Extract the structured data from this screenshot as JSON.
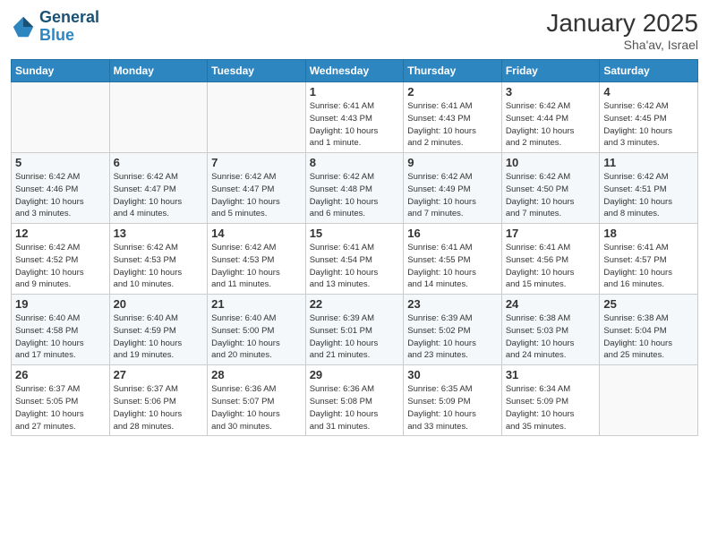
{
  "logo": {
    "line1": "General",
    "line2": "Blue"
  },
  "header": {
    "month": "January 2025",
    "location": "Sha'av, Israel"
  },
  "weekdays": [
    "Sunday",
    "Monday",
    "Tuesday",
    "Wednesday",
    "Thursday",
    "Friday",
    "Saturday"
  ],
  "weeks": [
    [
      {
        "day": "",
        "info": ""
      },
      {
        "day": "",
        "info": ""
      },
      {
        "day": "",
        "info": ""
      },
      {
        "day": "1",
        "info": "Sunrise: 6:41 AM\nSunset: 4:43 PM\nDaylight: 10 hours\nand 1 minute."
      },
      {
        "day": "2",
        "info": "Sunrise: 6:41 AM\nSunset: 4:43 PM\nDaylight: 10 hours\nand 2 minutes."
      },
      {
        "day": "3",
        "info": "Sunrise: 6:42 AM\nSunset: 4:44 PM\nDaylight: 10 hours\nand 2 minutes."
      },
      {
        "day": "4",
        "info": "Sunrise: 6:42 AM\nSunset: 4:45 PM\nDaylight: 10 hours\nand 3 minutes."
      }
    ],
    [
      {
        "day": "5",
        "info": "Sunrise: 6:42 AM\nSunset: 4:46 PM\nDaylight: 10 hours\nand 3 minutes."
      },
      {
        "day": "6",
        "info": "Sunrise: 6:42 AM\nSunset: 4:47 PM\nDaylight: 10 hours\nand 4 minutes."
      },
      {
        "day": "7",
        "info": "Sunrise: 6:42 AM\nSunset: 4:47 PM\nDaylight: 10 hours\nand 5 minutes."
      },
      {
        "day": "8",
        "info": "Sunrise: 6:42 AM\nSunset: 4:48 PM\nDaylight: 10 hours\nand 6 minutes."
      },
      {
        "day": "9",
        "info": "Sunrise: 6:42 AM\nSunset: 4:49 PM\nDaylight: 10 hours\nand 7 minutes."
      },
      {
        "day": "10",
        "info": "Sunrise: 6:42 AM\nSunset: 4:50 PM\nDaylight: 10 hours\nand 7 minutes."
      },
      {
        "day": "11",
        "info": "Sunrise: 6:42 AM\nSunset: 4:51 PM\nDaylight: 10 hours\nand 8 minutes."
      }
    ],
    [
      {
        "day": "12",
        "info": "Sunrise: 6:42 AM\nSunset: 4:52 PM\nDaylight: 10 hours\nand 9 minutes."
      },
      {
        "day": "13",
        "info": "Sunrise: 6:42 AM\nSunset: 4:53 PM\nDaylight: 10 hours\nand 10 minutes."
      },
      {
        "day": "14",
        "info": "Sunrise: 6:42 AM\nSunset: 4:53 PM\nDaylight: 10 hours\nand 11 minutes."
      },
      {
        "day": "15",
        "info": "Sunrise: 6:41 AM\nSunset: 4:54 PM\nDaylight: 10 hours\nand 13 minutes."
      },
      {
        "day": "16",
        "info": "Sunrise: 6:41 AM\nSunset: 4:55 PM\nDaylight: 10 hours\nand 14 minutes."
      },
      {
        "day": "17",
        "info": "Sunrise: 6:41 AM\nSunset: 4:56 PM\nDaylight: 10 hours\nand 15 minutes."
      },
      {
        "day": "18",
        "info": "Sunrise: 6:41 AM\nSunset: 4:57 PM\nDaylight: 10 hours\nand 16 minutes."
      }
    ],
    [
      {
        "day": "19",
        "info": "Sunrise: 6:40 AM\nSunset: 4:58 PM\nDaylight: 10 hours\nand 17 minutes."
      },
      {
        "day": "20",
        "info": "Sunrise: 6:40 AM\nSunset: 4:59 PM\nDaylight: 10 hours\nand 19 minutes."
      },
      {
        "day": "21",
        "info": "Sunrise: 6:40 AM\nSunset: 5:00 PM\nDaylight: 10 hours\nand 20 minutes."
      },
      {
        "day": "22",
        "info": "Sunrise: 6:39 AM\nSunset: 5:01 PM\nDaylight: 10 hours\nand 21 minutes."
      },
      {
        "day": "23",
        "info": "Sunrise: 6:39 AM\nSunset: 5:02 PM\nDaylight: 10 hours\nand 23 minutes."
      },
      {
        "day": "24",
        "info": "Sunrise: 6:38 AM\nSunset: 5:03 PM\nDaylight: 10 hours\nand 24 minutes."
      },
      {
        "day": "25",
        "info": "Sunrise: 6:38 AM\nSunset: 5:04 PM\nDaylight: 10 hours\nand 25 minutes."
      }
    ],
    [
      {
        "day": "26",
        "info": "Sunrise: 6:37 AM\nSunset: 5:05 PM\nDaylight: 10 hours\nand 27 minutes."
      },
      {
        "day": "27",
        "info": "Sunrise: 6:37 AM\nSunset: 5:06 PM\nDaylight: 10 hours\nand 28 minutes."
      },
      {
        "day": "28",
        "info": "Sunrise: 6:36 AM\nSunset: 5:07 PM\nDaylight: 10 hours\nand 30 minutes."
      },
      {
        "day": "29",
        "info": "Sunrise: 6:36 AM\nSunset: 5:08 PM\nDaylight: 10 hours\nand 31 minutes."
      },
      {
        "day": "30",
        "info": "Sunrise: 6:35 AM\nSunset: 5:09 PM\nDaylight: 10 hours\nand 33 minutes."
      },
      {
        "day": "31",
        "info": "Sunrise: 6:34 AM\nSunset: 5:09 PM\nDaylight: 10 hours\nand 35 minutes."
      },
      {
        "day": "",
        "info": ""
      }
    ]
  ]
}
